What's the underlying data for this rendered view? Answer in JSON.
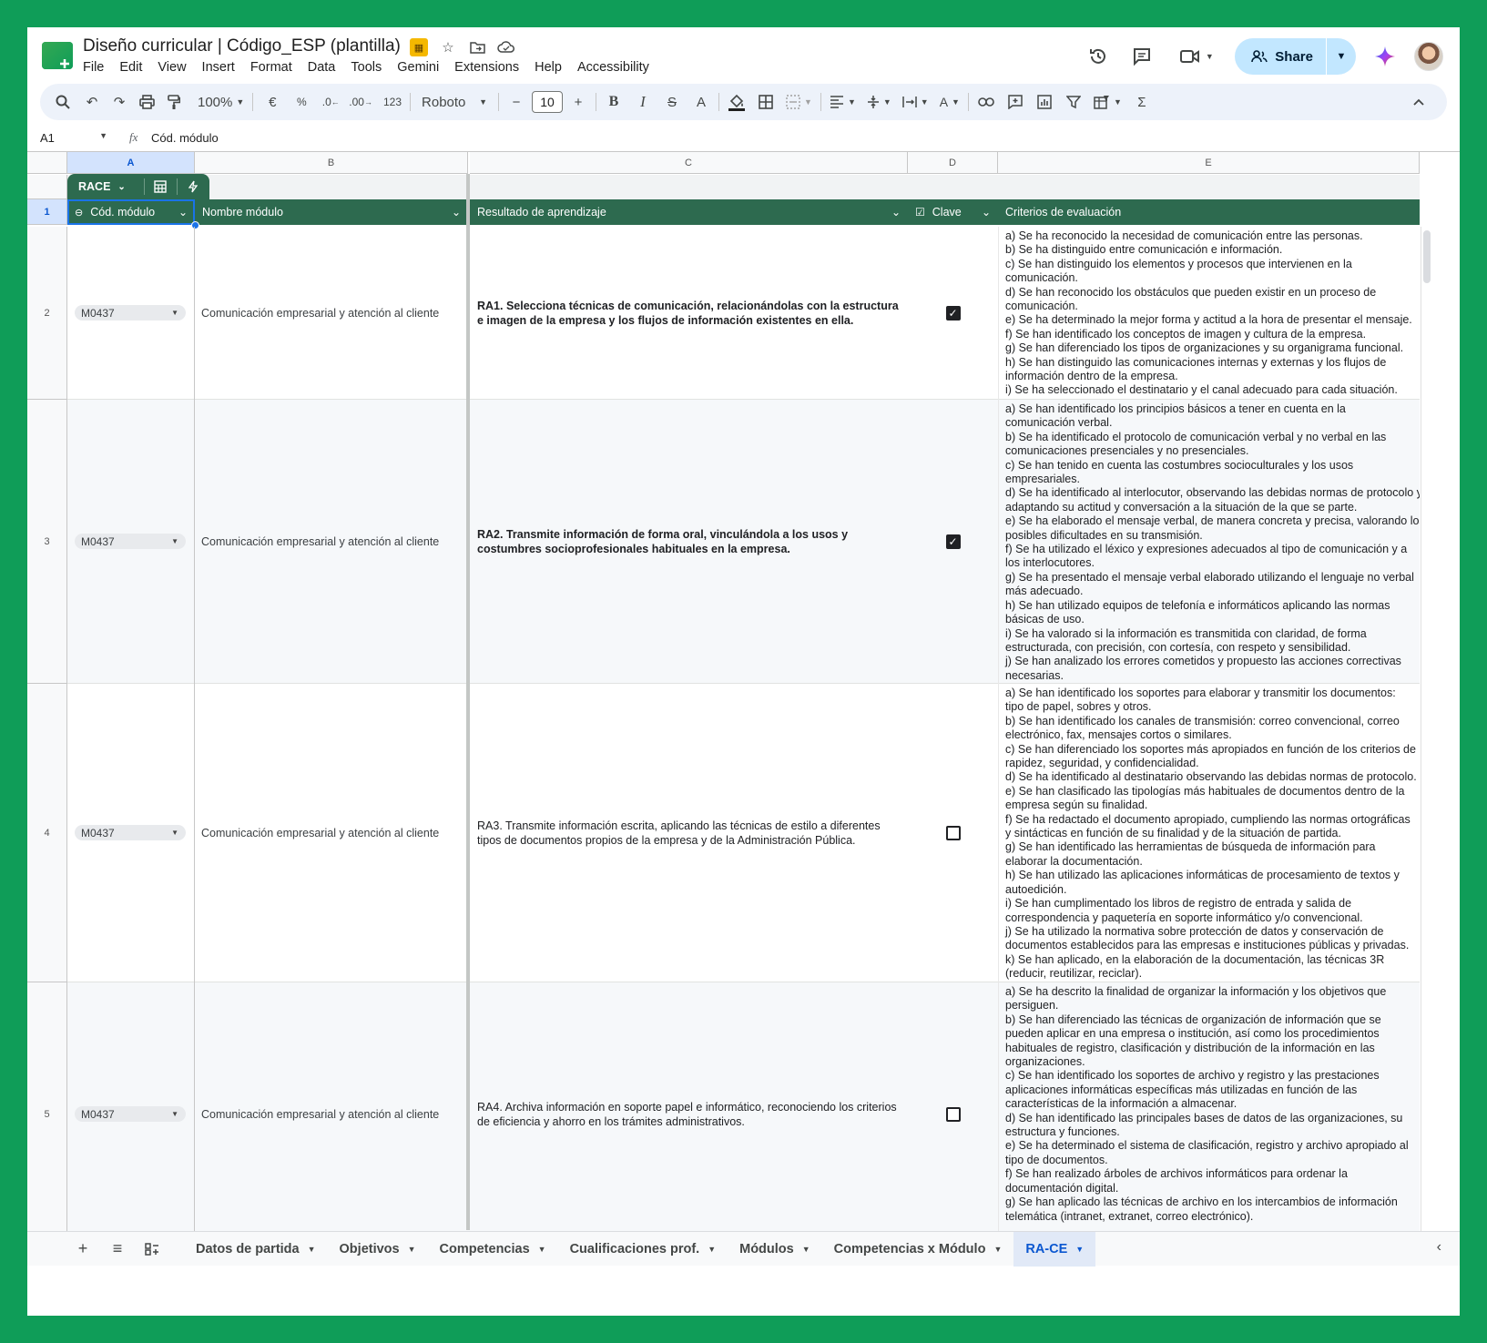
{
  "title": "Diseño curricular | Código_ESP (plantilla)",
  "menu": [
    "File",
    "Edit",
    "View",
    "Insert",
    "Format",
    "Data",
    "Tools",
    "Gemini",
    "Extensions",
    "Help",
    "Accessibility"
  ],
  "share_label": "Share",
  "toolbar": {
    "zoom": "100%",
    "currency": "€",
    "percent": "%",
    "dec_less": ".0",
    "dec_more": ".00",
    "number_format": "123",
    "font": "Roboto",
    "font_size": "10"
  },
  "formula_bar": {
    "cell_ref": "A1",
    "content": "Cód. módulo"
  },
  "columns": [
    "A",
    "B",
    "C",
    "D",
    "E"
  ],
  "table_name": "RACE",
  "headers": {
    "a": "Cód. módulo",
    "b": "Nombre módulo",
    "c": "Resultado de aprendizaje",
    "d": "Clave",
    "e": "Criterios de evaluación"
  },
  "row_numbers": [
    "1",
    "2",
    "3",
    "4",
    "5"
  ],
  "rows": [
    {
      "codigo": "M0437",
      "nombre": "Comunicación empresarial y atención al cliente",
      "resultado": "RA1. Selecciona técnicas de comunicación, relacionándolas con la estructura e imagen de la empresa y los flujos de información existentes en ella.",
      "clave": true,
      "criterios": [
        "a) Se ha reconocido la necesidad de comunicación entre las personas.",
        "b) Se ha distinguido entre comunicación e información.",
        "c) Se han distinguido los elementos y procesos que intervienen en la",
        "comunicación.",
        "d) Se han reconocido los obstáculos que pueden existir en un proceso de",
        "comunicación.",
        "e) Se ha determinado la mejor forma y actitud a la hora de presentar el mensaje.",
        "f) Se han identificado los conceptos de imagen y cultura de la empresa.",
        "g) Se han diferenciado los tipos de organizaciones y su organigrama funcional.",
        "h) Se han distinguido las comunicaciones internas y externas y los flujos de",
        "información dentro de la empresa.",
        "i) Se ha seleccionado el destinatario y el canal adecuado para cada situación."
      ]
    },
    {
      "codigo": "M0437",
      "nombre": "Comunicación empresarial y atención al cliente",
      "resultado": "RA2. Transmite información de forma oral, vinculándola a los usos y costumbres socioprofesionales habituales en la empresa.",
      "clave": true,
      "criterios": [
        "a) Se han identificado los principios básicos a tener en cuenta en la",
        "comunicación verbal.",
        "b) Se ha identificado el protocolo de comunicación verbal y no verbal en las",
        "comunicaciones presenciales y no presenciales.",
        "c) Se han tenido en cuenta las costumbres socioculturales y los usos",
        "empresariales.",
        "d) Se ha identificado al interlocutor, observando las debidas normas de protocolo y",
        "adaptando su actitud y conversación a la situación de la que se parte.",
        "e) Se ha elaborado el mensaje verbal, de manera concreta y precisa, valorando los",
        "posibles dificultades en su transmisión.",
        "f) Se ha utilizado el léxico y expresiones adecuados al tipo de comunicación y a",
        "los interlocutores.",
        "g) Se ha presentado el mensaje verbal elaborado utilizando el lenguaje no verbal",
        "más adecuado.",
        "h) Se han utilizado equipos de telefonía e informáticos aplicando las normas",
        "básicas de uso.",
        "i) Se ha valorado si la información es transmitida con claridad, de forma",
        "estructurada, con precisión, con cortesía, con respeto y sensibilidad.",
        "j) Se han analizado los errores cometidos y propuesto las acciones correctivas",
        "necesarias."
      ]
    },
    {
      "codigo": "M0437",
      "nombre": "Comunicación empresarial y atención al cliente",
      "resultado": "RA3. Transmite información escrita, aplicando las técnicas de estilo a diferentes tipos de documentos propios de la empresa y de la Administración Pública.",
      "clave": false,
      "criterios": [
        "a) Se han identificado los soportes para elaborar y transmitir los documentos:",
        "tipo de papel, sobres y otros.",
        "b) Se han identificado los canales de transmisión: correo convencional, correo",
        "electrónico, fax, mensajes cortos o similares.",
        "c) Se han diferenciado los soportes más apropiados en función de los criterios de",
        "rapidez, seguridad, y confidencialidad.",
        "d) Se ha identificado al destinatario observando las debidas normas de protocolo.",
        "e) Se han clasificado las tipologías más habituales de documentos dentro de la",
        "empresa según su finalidad.",
        "f) Se ha redactado el documento apropiado, cumpliendo las normas ortográficas",
        "y sintácticas en función de su finalidad y de la situación de partida.",
        "g) Se han identificado las herramientas de búsqueda de información para",
        "elaborar la documentación.",
        "h) Se han utilizado las aplicaciones informáticas de procesamiento de textos y",
        "autoedición.",
        "i) Se han cumplimentado los libros de registro de entrada y salida de",
        "correspondencia y paquetería en soporte informático y/o convencional.",
        "j) Se ha utilizado la normativa sobre protección de datos y conservación de",
        "documentos establecidos para las empresas e instituciones públicas y privadas.",
        "k) Se han aplicado, en la elaboración de la documentación, las técnicas 3R",
        "(reducir, reutilizar, reciclar)."
      ]
    },
    {
      "codigo": "M0437",
      "nombre": "Comunicación empresarial y atención al cliente",
      "resultado": "RA4. Archiva información en soporte papel e informático, reconociendo los criterios de eficiencia y ahorro en los trámites administrativos.",
      "clave": false,
      "criterios": [
        "a) Se ha descrito la finalidad de organizar la información y los objetivos que",
        "persiguen.",
        "b) Se han diferenciado las técnicas de organización de información que se",
        "pueden aplicar en una empresa o institución, así como los procedimientos",
        "habituales de registro, clasificación y distribución de la información en las",
        "organizaciones.",
        "c) Se han identificado los soportes de archivo y registro y las prestaciones",
        "aplicaciones informáticas específicas más utilizadas en función de las",
        "características de la información a almacenar.",
        "d) Se han identificado las principales bases de datos de las organizaciones, su",
        "estructura y funciones.",
        "e) Se ha determinado el sistema de clasificación, registro y archivo apropiado al",
        "tipo de documentos.",
        "f) Se han realizado árboles de archivos informáticos para ordenar la",
        "documentación digital.",
        "g) Se han aplicado las técnicas de archivo en los intercambios de información",
        "telemática (intranet, extranet, correo electrónico)."
      ]
    }
  ],
  "sheet_tabs": [
    "Datos de partida",
    "Objetivos",
    "Competencias",
    "Cualificaciones prof.",
    "Módulos",
    "Competencias x Módulo",
    "RA-CE"
  ],
  "active_sheet": "RA-CE",
  "colors": {
    "frame": "#0f9d58",
    "header_green": "#2d6a4f",
    "accent_blue": "#0b57d0",
    "share_bg": "#c2e7ff"
  }
}
